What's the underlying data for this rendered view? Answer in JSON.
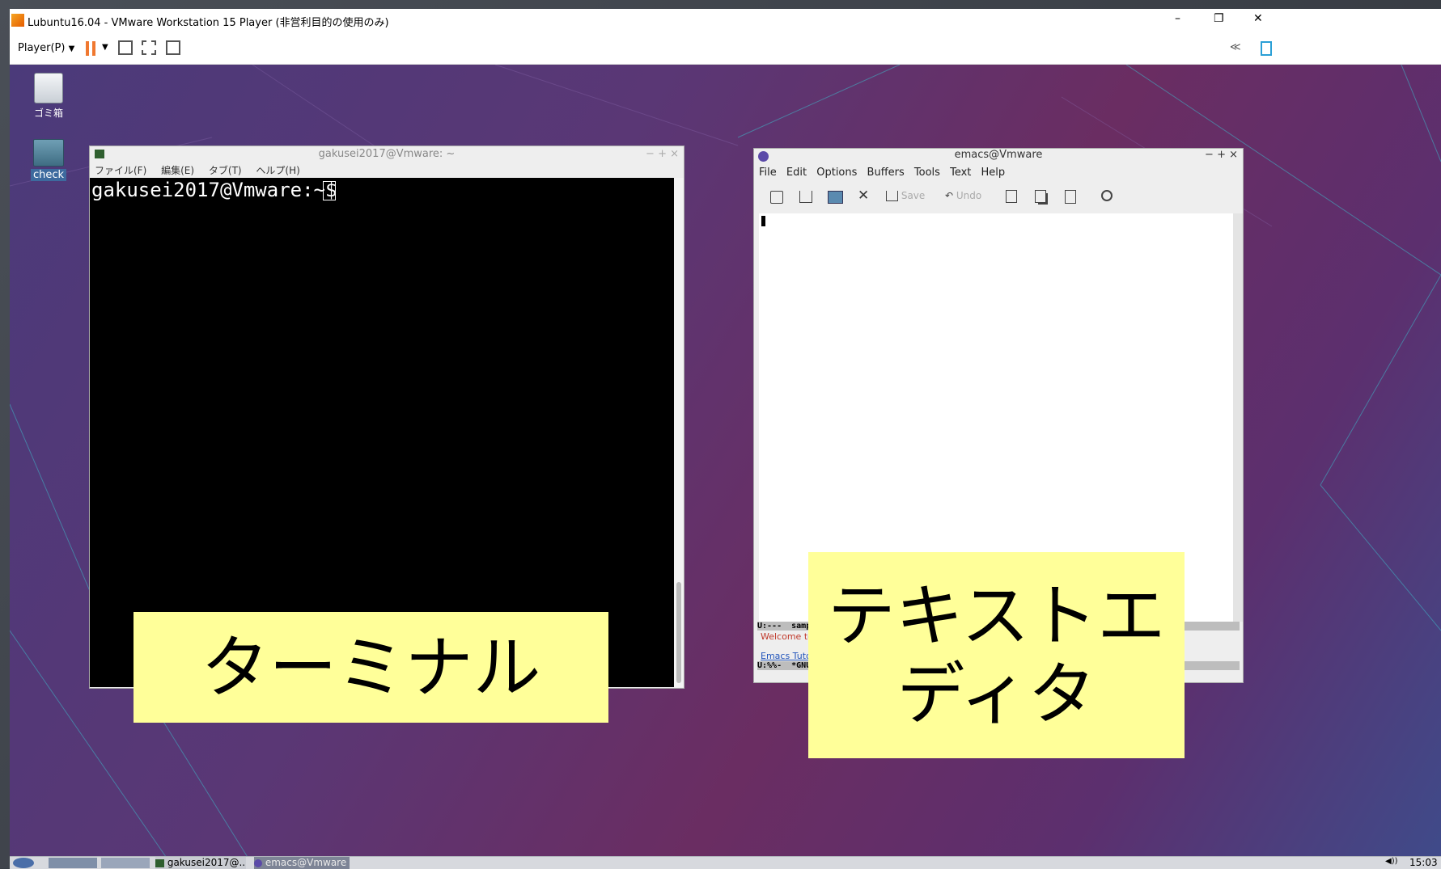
{
  "vm": {
    "title": "Lubuntu16.04 - VMware Workstation 15 Player (非営利目的の使用のみ)",
    "player_menu": "Player(P)",
    "controls": {
      "minimize": "–",
      "maximize": "❐",
      "close": "✕"
    },
    "collapse_symbol": "≪"
  },
  "desktop": {
    "icons": [
      {
        "label": "ゴミ箱",
        "icon": "trash-icon"
      },
      {
        "label": "check",
        "icon": "folder-icon"
      }
    ]
  },
  "terminal": {
    "title": "gakusei2017@Vmware: ~",
    "menu": [
      "ファイル(F)",
      "編集(E)",
      "タブ(T)",
      "ヘルプ(H)"
    ],
    "prompt": "gakusei2017@Vmware:~$ "
  },
  "emacs": {
    "title": "emacs@Vmware",
    "menu": [
      "File",
      "Edit",
      "Options",
      "Buffers",
      "Tools",
      "Text",
      "Help"
    ],
    "toolbar": {
      "save": "Save",
      "undo": "Undo"
    },
    "modeline1": "U:---  sample",
    "echo_welcome": "Welcome to G",
    "tutorial_link": "Emacs Tutori",
    "modeline2": "U:%%-  *GNU E"
  },
  "overlay_labels": {
    "terminal": "ターミナル",
    "editor_line1": "テキストエ",
    "editor_line2": "ディタ"
  },
  "taskbar": {
    "task1": "gakusei2017@...",
    "task2": "emacs@Vmware",
    "clock": "15:03",
    "volume": "◀))"
  },
  "colors": {
    "accent": "#f07830",
    "terminal_bg": "#000000",
    "label_bg": "#ffff99"
  }
}
